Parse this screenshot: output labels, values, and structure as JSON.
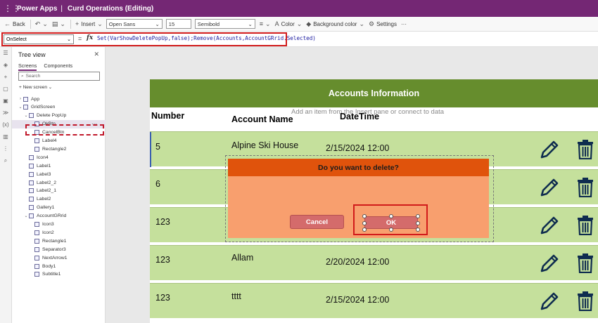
{
  "titlebar": {
    "app": "Power Apps",
    "separator": "|",
    "doc": "Curd Operations (Editing)"
  },
  "toolbar": {
    "back": "Back",
    "insert": "Insert",
    "font": "Open Sans",
    "size": "15",
    "weight": "Semibold",
    "color": "Color",
    "background": "Background color",
    "settings": "Settings",
    "more": "···"
  },
  "formula": {
    "property": "OnSelect",
    "eq": "=",
    "fx": "fx",
    "text": "Set(VarShowDeletePopUp,false);Remove(Accounts,AccountGRrid.Selected)"
  },
  "tree": {
    "title": "Tree view",
    "tabs": [
      "Screens",
      "Components"
    ],
    "search_placeholder": "Search",
    "new_screen": "New screen",
    "items": [
      {
        "label": "App",
        "indent": 1,
        "chev": "›"
      },
      {
        "label": "GridScreen",
        "indent": 1,
        "chev": "⌄"
      },
      {
        "label": "Delete PopUp",
        "indent": 2,
        "chev": "⌄"
      },
      {
        "label": "OkBtn",
        "indent": 3,
        "chev": ""
      },
      {
        "label": "CancelBtn",
        "indent": 3,
        "chev": ""
      },
      {
        "label": "Label4",
        "indent": 3,
        "chev": ""
      },
      {
        "label": "Rectangle2",
        "indent": 3,
        "chev": ""
      },
      {
        "label": "Icon4",
        "indent": 2,
        "chev": ""
      },
      {
        "label": "Label1",
        "indent": 2,
        "chev": ""
      },
      {
        "label": "Label3",
        "indent": 2,
        "chev": ""
      },
      {
        "label": "Label2_2",
        "indent": 2,
        "chev": ""
      },
      {
        "label": "Label2_1",
        "indent": 2,
        "chev": ""
      },
      {
        "label": "Label2",
        "indent": 2,
        "chev": ""
      },
      {
        "label": "Gallery1",
        "indent": 2,
        "chev": ""
      },
      {
        "label": "AccountGRrid",
        "indent": 2,
        "chev": "⌄"
      },
      {
        "label": "Icon3",
        "indent": 3,
        "chev": ""
      },
      {
        "label": "Icon2",
        "indent": 3,
        "chev": ""
      },
      {
        "label": "Rectangle1",
        "indent": 3,
        "chev": ""
      },
      {
        "label": "Separator3",
        "indent": 3,
        "chev": ""
      },
      {
        "label": "NextArrow1",
        "indent": 3,
        "chev": ""
      },
      {
        "label": "Body1",
        "indent": 3,
        "chev": ""
      },
      {
        "label": "Subtitle1",
        "indent": 3,
        "chev": ""
      }
    ],
    "more": "···"
  },
  "screen": {
    "header": "Accounts Information",
    "hint": "Add an item from the Insert pane or connect to data",
    "columns": {
      "number": "Number",
      "name": "Account Name",
      "datetime": "DateTime"
    },
    "rows": [
      {
        "number": "5",
        "name": "Alpine Ski House",
        "datetime": "2/15/2024 12:00"
      },
      {
        "number": "6",
        "name": "",
        "datetime": ""
      },
      {
        "number": "123",
        "name": "",
        "datetime": ""
      },
      {
        "number": "123",
        "name": "Allam",
        "datetime": "2/20/2024 12:00"
      },
      {
        "number": "123",
        "name": "tttt",
        "datetime": "2/15/2024 12:00"
      }
    ]
  },
  "popup": {
    "title": "Do you want to delete?",
    "cancel": "Cancel",
    "ok": "OK"
  },
  "colors": {
    "brand": "#742774",
    "header": "#668d2d",
    "row": "#c5e09c",
    "popup_head": "#e0530c",
    "popup_body": "#f89f6e",
    "button": "#d46b6b",
    "highlight": "#d11b1b"
  }
}
